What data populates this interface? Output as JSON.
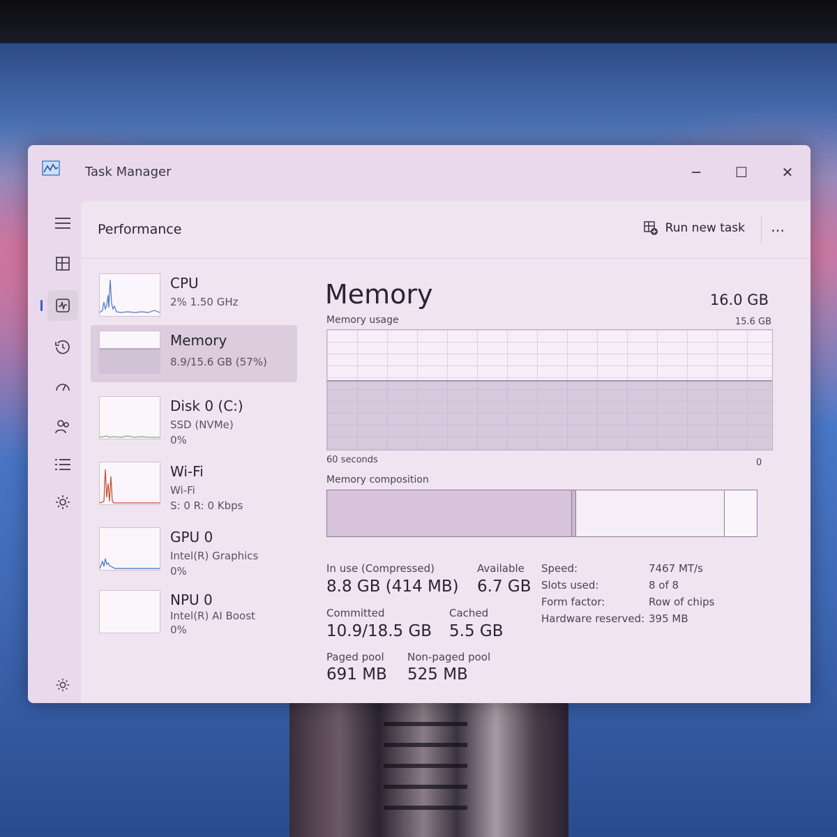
{
  "window": {
    "title": "Task Manager",
    "minimize": "─",
    "maximize": "☐",
    "close": "✕"
  },
  "header": {
    "title": "Performance",
    "run_new_task": "Run new task",
    "more": "⋯"
  },
  "nav": {
    "items": [
      {
        "name": "hamburger-menu-icon",
        "glyph": "☰"
      },
      {
        "name": "processes-icon",
        "glyph": "▦"
      },
      {
        "name": "performance-icon",
        "glyph": "⌇",
        "active": true
      },
      {
        "name": "app-history-icon",
        "glyph": "↺"
      },
      {
        "name": "startup-apps-icon",
        "glyph": "⚡"
      },
      {
        "name": "users-icon",
        "glyph": "👥"
      },
      {
        "name": "details-icon",
        "glyph": "≡"
      },
      {
        "name": "services-icon",
        "glyph": "⚙"
      }
    ],
    "settings": "⚙"
  },
  "devices": [
    {
      "name": "CPU",
      "line1": "2%  1.50 GHz",
      "line2": ""
    },
    {
      "name": "Memory",
      "line1": "8.9/15.6 GB (57%)",
      "line2": "",
      "selected": true
    },
    {
      "name": "Disk 0 (C:)",
      "line1": "SSD (NVMe)",
      "line2": "0%"
    },
    {
      "name": "Wi-Fi",
      "line1": "Wi-Fi",
      "line2": "S: 0  R: 0 Kbps"
    },
    {
      "name": "GPU 0",
      "line1": "Intel(R) Graphics",
      "line2": "0%"
    },
    {
      "name": "NPU 0",
      "line1": "Intel(R) AI Boost",
      "line2": "0%"
    }
  ],
  "detail": {
    "title": "Memory",
    "total": "16.0 GB",
    "usage_label": "Memory usage",
    "usage_max": "15.6 GB",
    "time_left": "60 seconds",
    "time_right": "0",
    "usage_fraction": 0.57,
    "composition_label": "Memory composition",
    "composition": {
      "in_use": 0.57,
      "modified": 0.01,
      "standby": 0.345,
      "free": 0.075
    },
    "stats": {
      "in_use_label": "In use (Compressed)",
      "in_use_value": "8.8 GB (414 MB)",
      "available_label": "Available",
      "available_value": "6.7 GB",
      "committed_label": "Committed",
      "committed_value": "10.9/18.5 GB",
      "cached_label": "Cached",
      "cached_value": "5.5 GB",
      "paged_label": "Paged pool",
      "paged_value": "691 MB",
      "nonpaged_label": "Non-paged pool",
      "nonpaged_value": "525 MB"
    },
    "specs": [
      {
        "key": "Speed:",
        "value": "7467 MT/s"
      },
      {
        "key": "Slots used:",
        "value": "8 of 8"
      },
      {
        "key": "Form factor:",
        "value": "Row of chips"
      },
      {
        "key": "Hardware reserved:",
        "value": "395 MB"
      }
    ]
  },
  "colors": {
    "accent": "#3060c0",
    "panel": "#f0e4f1",
    "window": "#ead9ec"
  }
}
